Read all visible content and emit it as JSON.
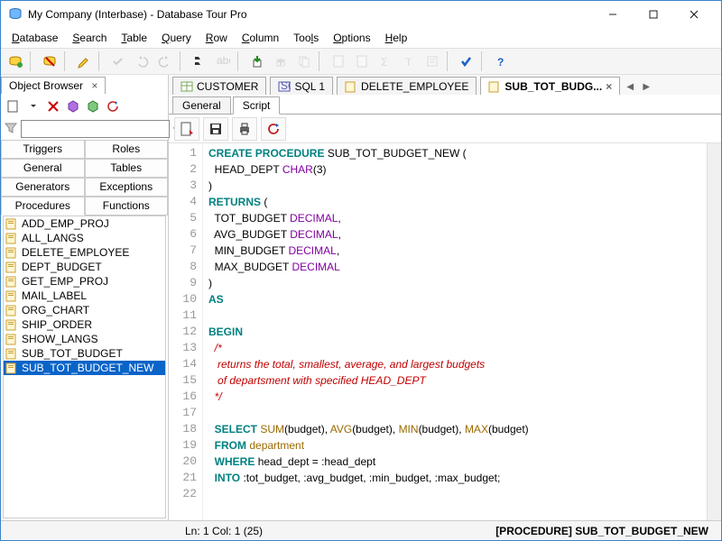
{
  "window": {
    "title": "My Company (Interbase) - Database Tour Pro"
  },
  "menu": {
    "database": "Database",
    "search": "Search",
    "table": "Table",
    "query": "Query",
    "row": "Row",
    "column": "Column",
    "tools": "Tools",
    "options": "Options",
    "help": "Help"
  },
  "objectBrowser": {
    "title": "Object Browser",
    "filter": {
      "placeholder": ""
    },
    "cats": {
      "triggers": "Triggers",
      "roles": "Roles",
      "general": "General",
      "tables": "Tables",
      "generators": "Generators",
      "exceptions": "Exceptions",
      "procedures": "Procedures",
      "functions": "Functions"
    },
    "items": [
      "ADD_EMP_PROJ",
      "ALL_LANGS",
      "DELETE_EMPLOYEE",
      "DEPT_BUDGET",
      "GET_EMP_PROJ",
      "MAIL_LABEL",
      "ORG_CHART",
      "SHIP_ORDER",
      "SHOW_LANGS",
      "SUB_TOT_BUDGET",
      "SUB_TOT_BUDGET_NEW"
    ],
    "selectedIndex": 10
  },
  "docTabs": [
    {
      "label": "CUSTOMER",
      "kind": "table"
    },
    {
      "label": "SQL 1",
      "kind": "sql"
    },
    {
      "label": "DELETE_EMPLOYEE",
      "kind": "proc"
    },
    {
      "label": "SUB_TOT_BUDG...",
      "kind": "proc",
      "active": true
    }
  ],
  "innerTabs": {
    "general": "General",
    "script": "Script"
  },
  "code": {
    "lines": [
      [
        [
          "kw",
          "CREATE"
        ],
        [
          "sp",
          " "
        ],
        [
          "kw",
          "PROCEDURE"
        ],
        [
          "sp",
          " "
        ],
        [
          "id",
          "SUB_TOT_BUDGET_NEW ("
        ]
      ],
      [
        [
          "sp",
          "  "
        ],
        [
          "id",
          "HEAD_DEPT "
        ],
        [
          "ty",
          "CHAR"
        ],
        [
          "id",
          "(3)"
        ]
      ],
      [
        [
          "id",
          ")"
        ]
      ],
      [
        [
          "kw",
          "RETURNS"
        ],
        [
          "id",
          " ("
        ]
      ],
      [
        [
          "sp",
          "  "
        ],
        [
          "id",
          "TOT_BUDGET "
        ],
        [
          "ty",
          "DECIMAL"
        ],
        [
          "id",
          ","
        ]
      ],
      [
        [
          "sp",
          "  "
        ],
        [
          "id",
          "AVG_BUDGET "
        ],
        [
          "ty",
          "DECIMAL"
        ],
        [
          "id",
          ","
        ]
      ],
      [
        [
          "sp",
          "  "
        ],
        [
          "id",
          "MIN_BUDGET "
        ],
        [
          "ty",
          "DECIMAL"
        ],
        [
          "id",
          ","
        ]
      ],
      [
        [
          "sp",
          "  "
        ],
        [
          "id",
          "MAX_BUDGET "
        ],
        [
          "ty",
          "DECIMAL"
        ]
      ],
      [
        [
          "id",
          ")"
        ]
      ],
      [
        [
          "kw",
          "AS"
        ]
      ],
      [
        [
          "sp",
          ""
        ]
      ],
      [
        [
          "kw",
          "BEGIN"
        ]
      ],
      [
        [
          "sp",
          "  "
        ],
        [
          "cm",
          "/*"
        ]
      ],
      [
        [
          "sp",
          "   "
        ],
        [
          "cm",
          "returns the total, smallest, average, and largest budgets"
        ]
      ],
      [
        [
          "sp",
          "   "
        ],
        [
          "cm",
          "of departsment with specified HEAD_DEPT"
        ]
      ],
      [
        [
          "sp",
          "  "
        ],
        [
          "cm",
          "*/"
        ]
      ],
      [
        [
          "sp",
          ""
        ]
      ],
      [
        [
          "sp",
          "  "
        ],
        [
          "kw",
          "SELECT"
        ],
        [
          "sp",
          " "
        ],
        [
          "fn",
          "SUM"
        ],
        [
          "id",
          "(budget), "
        ],
        [
          "fn",
          "AVG"
        ],
        [
          "id",
          "(budget), "
        ],
        [
          "fn",
          "MIN"
        ],
        [
          "id",
          "(budget), "
        ],
        [
          "fn",
          "MAX"
        ],
        [
          "id",
          "(budget)"
        ]
      ],
      [
        [
          "sp",
          "  "
        ],
        [
          "kw",
          "FROM"
        ],
        [
          "sp",
          " "
        ],
        [
          "fn",
          "department"
        ]
      ],
      [
        [
          "sp",
          "  "
        ],
        [
          "kw",
          "WHERE"
        ],
        [
          "sp",
          " "
        ],
        [
          "id",
          "head_dept = :head_dept"
        ]
      ],
      [
        [
          "sp",
          "  "
        ],
        [
          "kw",
          "INTO"
        ],
        [
          "sp",
          " "
        ],
        [
          "id",
          ":tot_budget, :avg_budget, :min_budget, :max_budget;"
        ]
      ],
      [
        [
          "sp",
          ""
        ]
      ]
    ]
  },
  "status": {
    "pos": "Ln: 1  Col: 1 (25)",
    "obj": "[PROCEDURE] SUB_TOT_BUDGET_NEW"
  }
}
